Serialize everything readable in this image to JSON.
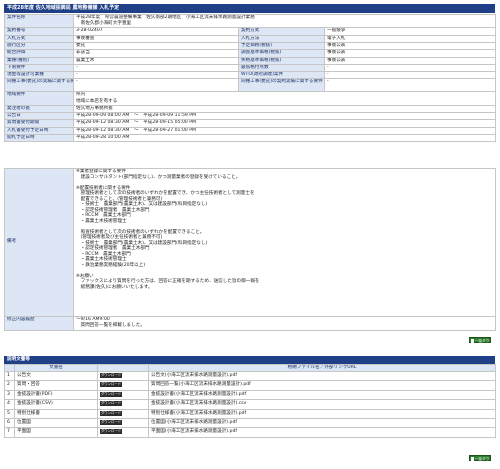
{
  "header_title": "平成28年度 佐久地域振興局 農地整備課 入札予定",
  "rows_top": [
    {
      "label": "案件名称",
      "value": "平成28年度　県営農道整備事業　佐久南部2期地区　小海工区流末排水路測量設計業務\n　南佐久郡小海町大字豊里"
    },
    {
      "label": "契約番号",
      "value": "3-28-02407",
      "label2": "契約方式",
      "value2": "一般競争"
    },
    {
      "label": "入札方式",
      "value": "事後審査",
      "label2": "入札方法",
      "value2": "電子入札"
    },
    {
      "label": "施行区分",
      "value": "委託",
      "label2": "予定価格(税抜)",
      "value2": "事後公表"
    },
    {
      "label": "総合評価",
      "value": "非該当",
      "label2": "調査基準価格(税抜)",
      "value2": "事後公表"
    },
    {
      "label": "業種(種別)",
      "value": "農業土木",
      "label2": "失格基準価格(税抜)",
      "value2": "事後公表"
    },
    {
      "label": "下限要件",
      "value": "-",
      "label2": "最低格付点数",
      "value2": "-"
    },
    {
      "label": "現金等設計可業種",
      "value": "-",
      "label2": "WTO(政府調達)案件",
      "value2": "-"
    },
    {
      "label": "同種工事(委託)の実績に関する要件",
      "value": "-",
      "label2": "同種工事(委託)の契約実績に関する要件",
      "value2": "-"
    },
    {
      "label": "地域要件",
      "value": "県内\n地域に本店を有する"
    },
    {
      "label": "発注者の長",
      "value": "佐久地方事務所長"
    },
    {
      "label": "公告日",
      "value": "平成28-09-09 08:00 AM　～　平成28-09-09 11:59 PM"
    },
    {
      "label": "質問書受付期間",
      "value": "平成28-09-12 08:30 AM　～　平成28-09-15 05:00 PM"
    },
    {
      "label": "入札書受付予定日時",
      "value": "平成28-09-12 08:30 AM　～　平成28-09-27 01:00 PM"
    },
    {
      "label": "開札予定日時",
      "value": "平成28-09-28 10:00 AM"
    }
  ],
  "remarks_label": "備考",
  "remarks_text": "※業者登録に関する要件\n　建設コンサルタント(部門指定なし)、かつ測量業者の登録を受けていること。\n\n※配置技術者に関する要件\n　管理技術者として次の技術者のいずれかを配置でき、かつ主任技術者として測量士を\n　配置できること。(管理技術者と兼務可)\n　・技術士　農業部門(農業土木)、又は建設部門(科目指定なし)\n　・認定技術管理者　農業土木部門\n　・RCCM　農業土木部門\n　・農業土木技術管理士\n\n　照査技術者として次の技術者のいずれかを配置できること。\n　(管理技術者及び主任技術者と兼務不可)\n　・技術士　農業部門(農業土木)、又は建設部門(科目指定なし)\n　・認定技術管理者　農業土木部門\n　・RCCM　農業土木部門\n　・農業土木技術管理士\n　・鉄治業務実務経験(20年以上)\n\n※お願い\n　ファックスにより質問を行った方は、回答に正確を期するため、送信した旨の御一報を\n　総務課(佐久)にお願いいたします。",
  "revision_label": "修正内容履歴",
  "revision_text": "～9/16 AM9:00\n　質問回答一覧を掲載しました。",
  "btn_bulk_download": "一括ダウンロード",
  "section2_title": "説明文書等",
  "files_header": {
    "no": "",
    "name": "文書名",
    "dl": "",
    "file": "格納ファイル名／外部リンクURL"
  },
  "download_label": "ダウンロード",
  "files": [
    {
      "no": "1",
      "name": "公告文",
      "file": "公告文(小海工区流末排水路測量設計).pdf"
    },
    {
      "no": "2",
      "name": "質問・回答",
      "file": "質問回答一覧(小海工区流末排水路測量設計).pdf"
    },
    {
      "no": "3",
      "name": "金抜設計書(PDF)",
      "file": "金抜設計書(小海工区流末排水路測量設計).pdf"
    },
    {
      "no": "4",
      "name": "金抜設計書(CSV)",
      "file": "金抜設計書(小海工区流末排水路測量設計).csv"
    },
    {
      "no": "5",
      "name": "特別仕様書",
      "file": "特別仕様書(小海工区流末排水路測量設計).pdf"
    },
    {
      "no": "6",
      "name": "位置図",
      "file": "位置図(小海工区流末排水路測量設計).pdf"
    },
    {
      "no": "7",
      "name": "平面図",
      "file": "平面図(小海工区流末排水路測量設計).pdf"
    }
  ]
}
